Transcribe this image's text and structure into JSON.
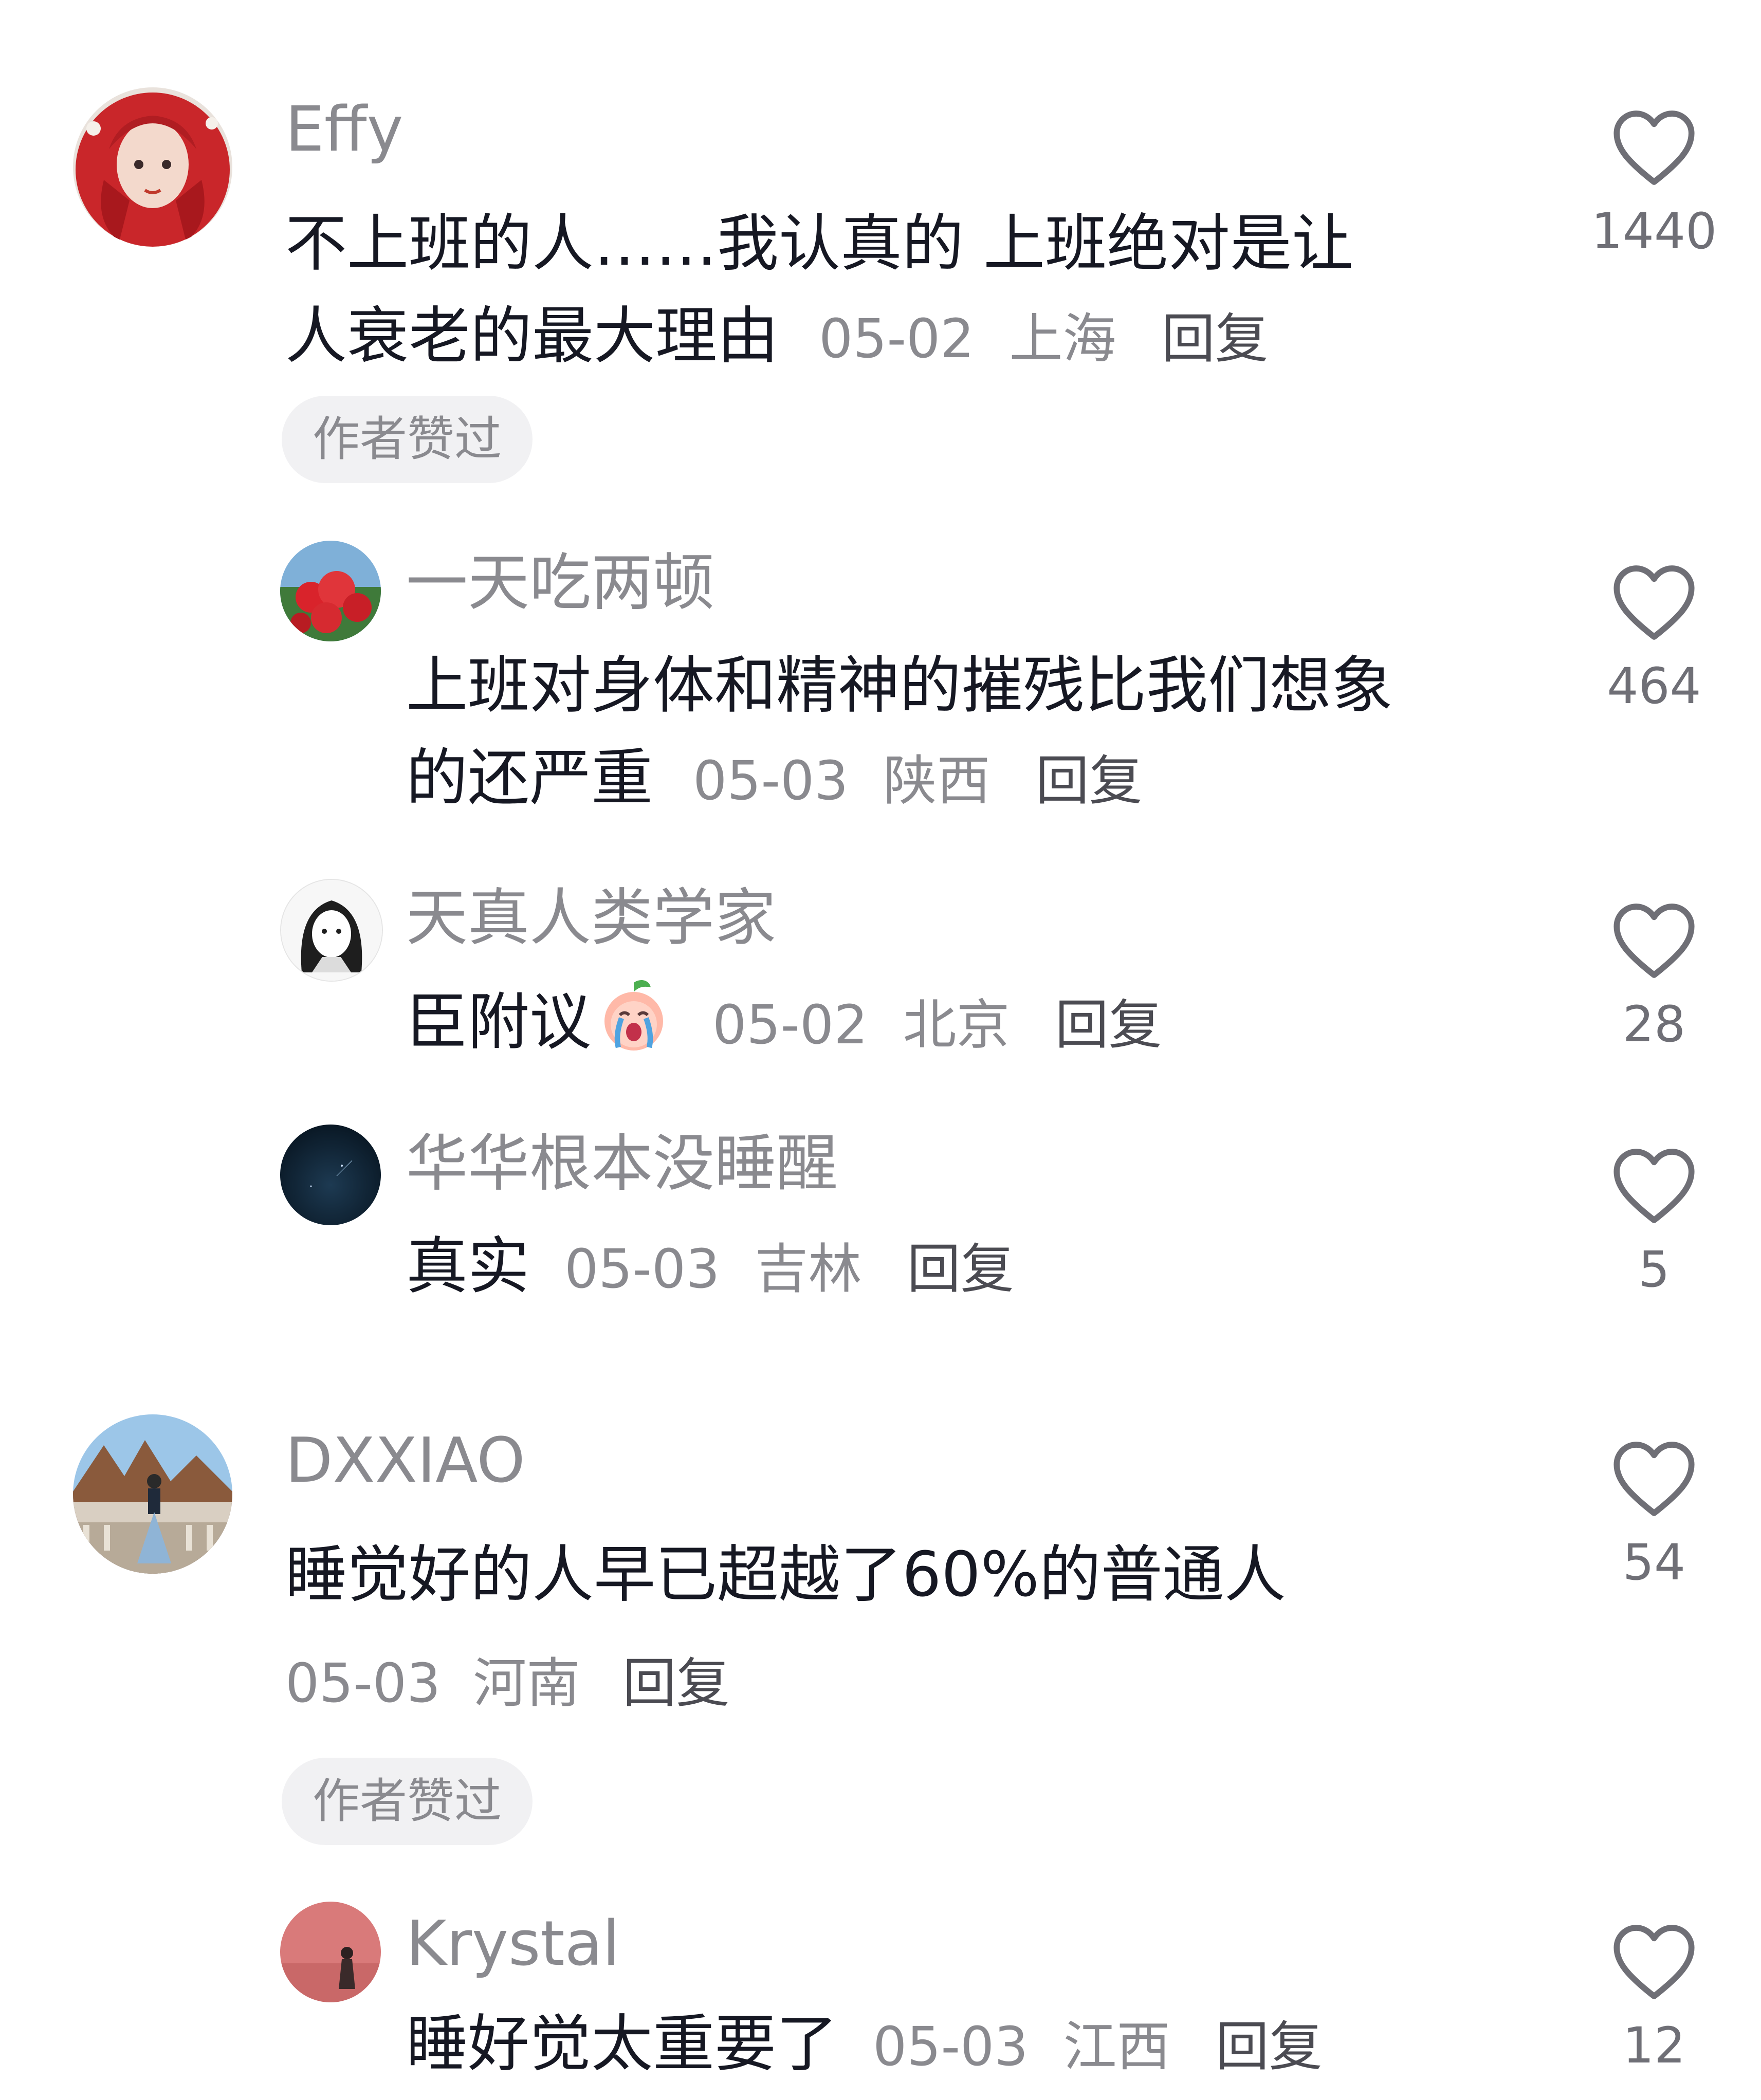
{
  "comments": [
    {
      "username": "Effy",
      "text_line1": "不上班的人……我认真的 上班绝对是让",
      "text_line2": "人衰老的最大理由",
      "date": "05-02",
      "location": "上海",
      "reply_label": "回复",
      "badge": "作者赞过",
      "likes": "1440",
      "avatar": "red-hair-illustrated-avatar",
      "replies": [
        {
          "username": "一天吃两顿",
          "text_line1": "上班对身体和精神的摧残比我们想象",
          "text_line2": "的还严重",
          "date": "05-03",
          "location": "陕西",
          "reply_label": "回复",
          "likes": "464",
          "avatar": "red-flowers-photo-avatar"
        },
        {
          "username": "天真人类学家",
          "text": "臣附议",
          "emoji": "crying-peach-emoji",
          "date": "05-02",
          "location": "北京",
          "reply_label": "回复",
          "likes": "28",
          "avatar": "sketch-girl-avatar"
        },
        {
          "username": "华华根本没睡醒",
          "text": "真实",
          "date": "05-03",
          "location": "吉林",
          "reply_label": "回复",
          "likes": "5",
          "avatar": "night-sky-avatar"
        }
      ]
    },
    {
      "username": "DXXIAO",
      "text": "睡觉好的人早已超越了60%的普通人",
      "date": "05-03",
      "location": "河南",
      "reply_label": "回复",
      "badge": "作者赞过",
      "likes": "54",
      "avatar": "travel-photo-avatar",
      "replies": [
        {
          "username": "Krystal",
          "text": "睡好觉太重要了",
          "date": "05-03",
          "location": "江西",
          "reply_label": "回复",
          "likes": "12",
          "avatar": "pink-wall-portrait-avatar"
        }
      ]
    }
  ],
  "colors": {
    "text": "#161823",
    "secondary": "#8a8a8f",
    "badge_bg": "#f1f1f3",
    "heart_stroke": "#6f6f76"
  }
}
